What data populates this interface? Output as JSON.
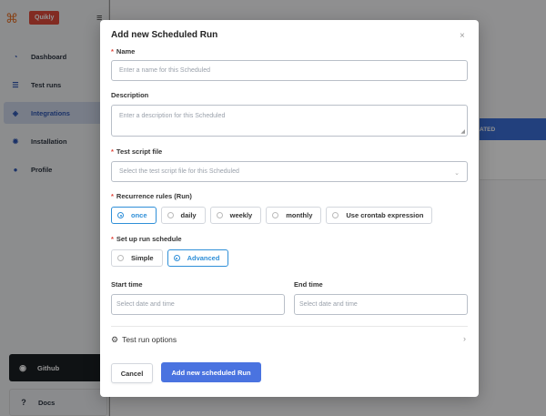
{
  "app": {
    "logo_text": "Quikly",
    "nav": [
      {
        "label": "Dashboard"
      },
      {
        "label": "Test runs"
      },
      {
        "label": "Integrations"
      },
      {
        "label": "Installation"
      },
      {
        "label": "Profile"
      }
    ],
    "github_label": "Github",
    "docs_label": "Docs",
    "table_header_fragment": "ATED"
  },
  "modal": {
    "title": "Add new Scheduled Run",
    "name": {
      "label": "Name",
      "placeholder": "Enter a name for this Scheduled"
    },
    "description": {
      "label": "Description",
      "placeholder": "Enter a description for this Scheduled"
    },
    "test_script": {
      "label": "Test script file",
      "placeholder": "Select the test script file for this Scheduled"
    },
    "recurrence": {
      "label": "Recurrence rules (Run)",
      "options": [
        "once",
        "daily",
        "weekly",
        "monthly",
        "Use crontab expression"
      ],
      "selected": "once"
    },
    "schedule": {
      "label": "Set up run schedule",
      "options": [
        "Simple",
        "Advanced"
      ],
      "selected": "Advanced"
    },
    "start_time": {
      "label": "Start time",
      "placeholder": "Select date and time"
    },
    "end_time": {
      "label": "End time",
      "placeholder": "Select date and time"
    },
    "test_run_options_label": "Test run options",
    "cancel_label": "Cancel",
    "submit_label": "Add new scheduled Run"
  },
  "colors": {
    "primary": "#4a73e0",
    "accent": "#2f8fd8",
    "required": "#e0453a",
    "sidebar_active": "#cfd8ea"
  }
}
